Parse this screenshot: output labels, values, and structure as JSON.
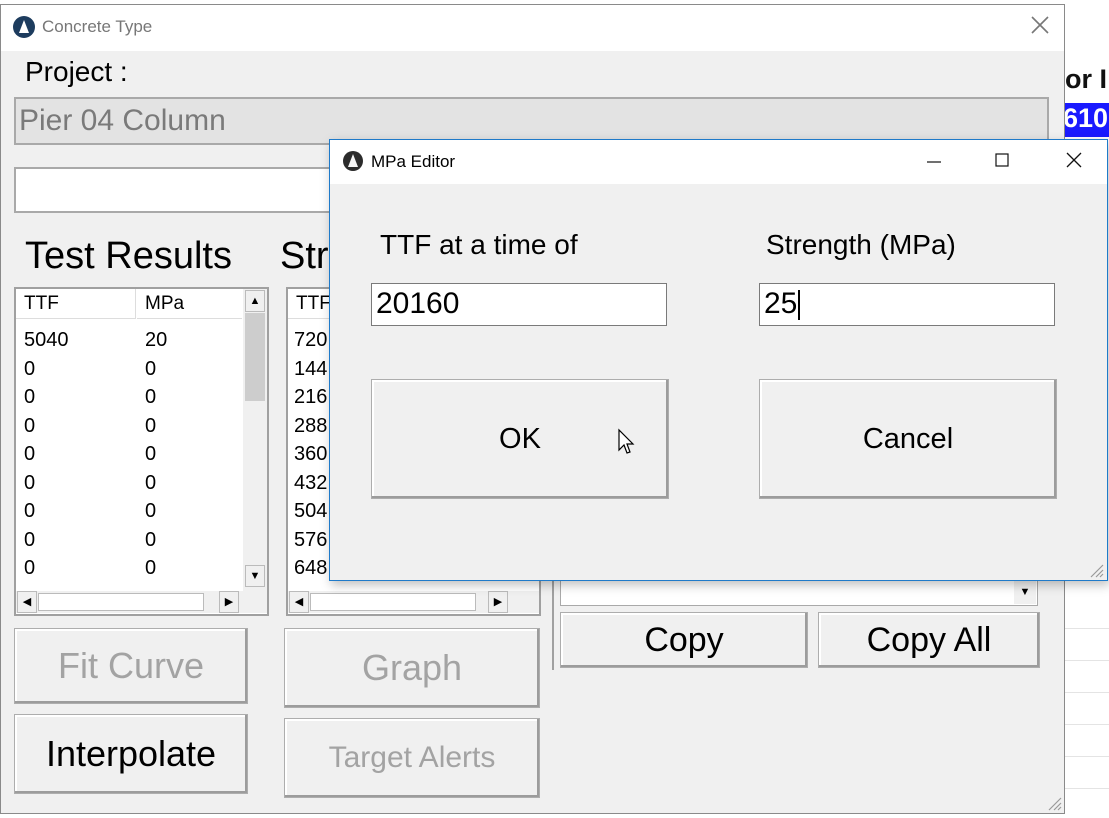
{
  "background_window": {
    "header_text": "or I",
    "selected_cell": "610"
  },
  "window": {
    "title": "Concrete Type",
    "project_label": "Project :",
    "project_value": "Pier 04 Column",
    "test_results_heading": "Test Results",
    "strength_heading": "Str",
    "test_results_table": {
      "columns": [
        "TTF",
        "MPa"
      ],
      "rows": [
        [
          "5040",
          "20"
        ],
        [
          "0",
          "0"
        ],
        [
          "0",
          "0"
        ],
        [
          "0",
          "0"
        ],
        [
          "0",
          "0"
        ],
        [
          "0",
          "0"
        ],
        [
          "0",
          "0"
        ],
        [
          "0",
          "0"
        ],
        [
          "0",
          "0"
        ]
      ]
    },
    "strength_table": {
      "columns": [
        "TTF"
      ],
      "rows": [
        "720",
        "144",
        "216",
        "288",
        "360",
        "432",
        "504",
        "576",
        "648"
      ]
    },
    "buttons": {
      "fit_curve": "Fit Curve",
      "graph": "Graph",
      "interpolate": "Interpolate",
      "target_alerts": "Target Alerts",
      "copy": "Copy",
      "copy_all": "Copy All"
    }
  },
  "dialog": {
    "title": "MPa Editor",
    "ttf_label": "TTF at a time of",
    "ttf_value": "20160",
    "strength_label": "Strength (MPa)",
    "strength_value": "25",
    "ok_label": "OK",
    "cancel_label": "Cancel",
    "minimize_glyph": "—",
    "maximize_glyph": "☐",
    "close_glyph": "✕"
  },
  "colors": {
    "selection_blue": "#1a1aff",
    "dialog_border": "#1f7ac9",
    "disabled_text": "#a3a3a3"
  }
}
